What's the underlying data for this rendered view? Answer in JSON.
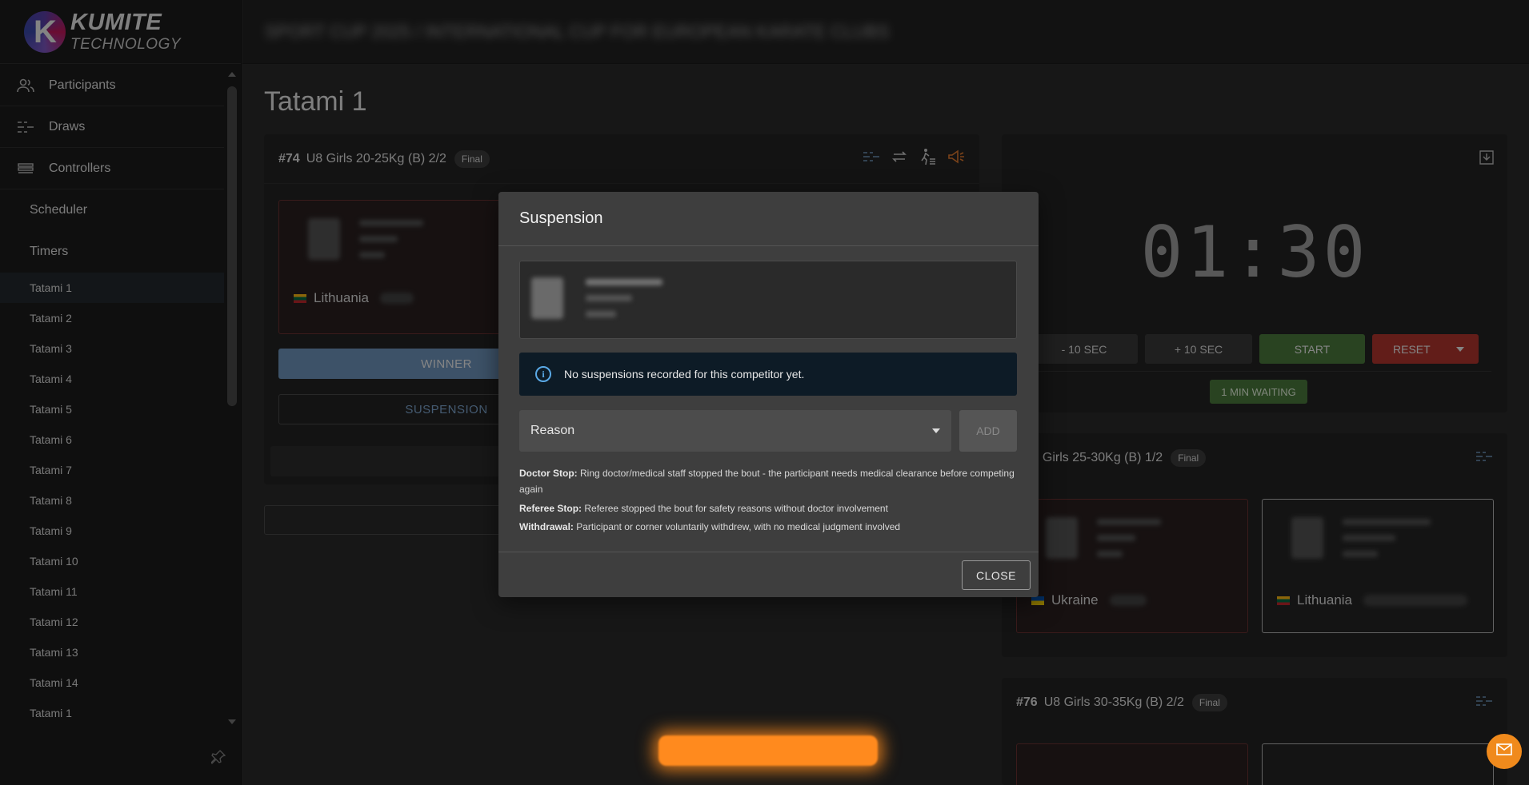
{
  "brand": {
    "line1": "KUMITE",
    "line2": "TECHNOLOGY"
  },
  "topbar": {
    "event_title": "SPORT CUP 2025 / INTERNATIONAL CUP FOR EUROPEAN KARATE CLUBS"
  },
  "sidebar": {
    "main": [
      {
        "label": "Participants",
        "icon": "users-icon"
      },
      {
        "label": "Draws",
        "icon": "draws-icon"
      },
      {
        "label": "Controllers",
        "icon": "controllers-icon"
      }
    ],
    "sub": [
      "Scheduler",
      "Timers"
    ],
    "tatamis": [
      "Tatami 1",
      "Tatami 2",
      "Tatami 3",
      "Tatami 4",
      "Tatami 5",
      "Tatami 6",
      "Tatami 7",
      "Tatami 8",
      "Tatami 9",
      "Tatami 10",
      "Tatami 11",
      "Tatami 12",
      "Tatami 13",
      "Tatami 14",
      "Tatami 1"
    ],
    "active_index": 0
  },
  "page": {
    "title": "Tatami 1"
  },
  "current_match": {
    "number": "#74",
    "name": "U8 Girls 20-25Kg (B) 2/2",
    "badge": "Final",
    "red_country": "Lithuania",
    "winner_label": "WINNER",
    "suspension_label": "SUSPENSION"
  },
  "timer": {
    "display": "01:30",
    "minus_label": "- 10 SEC",
    "plus_label": "+ 10 SEC",
    "start_label": "START",
    "reset_label": "RESET",
    "waiting_label": "1 MIN WAITING"
  },
  "next_matches": [
    {
      "number": "",
      "name": "U8 Girls 25-30Kg (B) 1/2",
      "badge": "Final",
      "red_country": "Ukraine",
      "white_country": "Lithuania"
    },
    {
      "number": "#76",
      "name": "U8 Girls 30-35Kg (B) 2/2",
      "badge": "Final"
    }
  ],
  "modal": {
    "title": "Suspension",
    "alert": "No suspensions recorded for this competitor yet.",
    "reason_placeholder": "Reason",
    "add_label": "ADD",
    "descriptions": [
      {
        "term": "Doctor Stop:",
        "text": " Ring doctor/medical staff stopped the bout - the participant needs medical clearance before competing again"
      },
      {
        "term": "Referee Stop:",
        "text": " Referee stopped the bout for safety reasons without doctor involvement"
      },
      {
        "term": "Withdrawal:",
        "text": " Participant or corner voluntarily withdrew, with no medical judgment involved"
      }
    ],
    "close_label": "CLOSE"
  },
  "colors": {
    "accent_blue": "#6f95bd",
    "start_green": "#4b7a3c",
    "reset_red": "#b3362e",
    "fab_orange": "#f08a1c"
  }
}
